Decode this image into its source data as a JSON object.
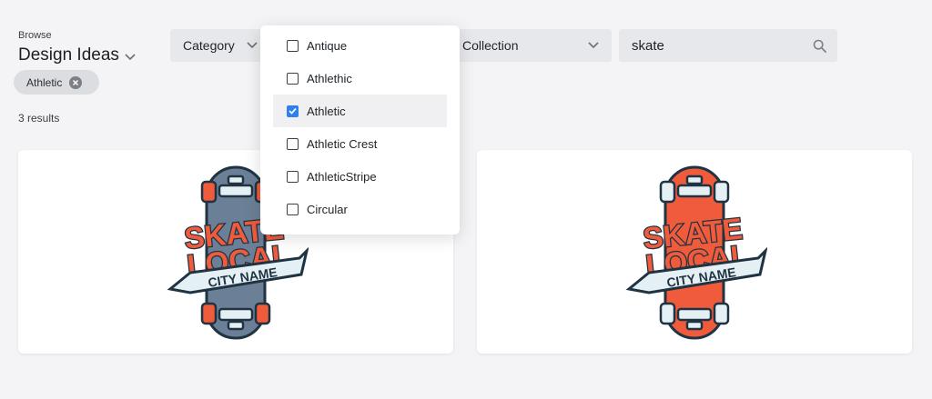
{
  "header": {
    "browse_label": "Browse",
    "title": "Design Ideas"
  },
  "active_filters": [
    {
      "label": "Athletic"
    }
  ],
  "results_text": "3 results",
  "filters": {
    "category_label": "Category",
    "collection_label": "Collection",
    "search_value": "skate"
  },
  "dropdown": {
    "items": [
      {
        "label": "Antique",
        "checked": false
      },
      {
        "label": "Athlethic",
        "checked": false
      },
      {
        "label": "Athletic",
        "checked": true
      },
      {
        "label": "Athletic Crest",
        "checked": false
      },
      {
        "label": "AthleticStripe",
        "checked": false
      },
      {
        "label": "Circular",
        "checked": false
      }
    ]
  },
  "cards": [
    {
      "line1": "SKATE",
      "line2": "LOCAL",
      "banner": "CITY NAME",
      "board_color": "#6b7f96",
      "accent": "#ef5b3b"
    },
    {
      "line1": "SKATE",
      "line2": "LOCAL",
      "banner": "CITY NAME",
      "board_color": "#ef5b3b",
      "accent": "#ef5b3b"
    }
  ],
  "colors": {
    "check_blue": "#2f80ed",
    "dark_navy": "#1f3342",
    "tint": "#e5f0f4"
  }
}
